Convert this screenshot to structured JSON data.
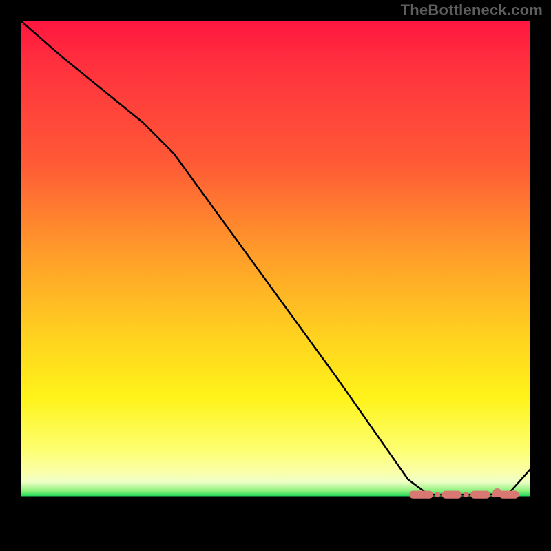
{
  "watermark": "TheBottleneck.com",
  "chart_data": {
    "type": "line",
    "title": "",
    "xlabel": "",
    "ylabel": "",
    "xlim": [
      0,
      100
    ],
    "ylim": [
      0,
      100
    ],
    "grid": false,
    "legend": false,
    "series": [
      {
        "name": "curve",
        "style": "solid-black",
        "x": [
          0,
          8,
          24,
          30,
          46,
          62,
          76,
          80,
          84,
          88,
          92,
          96,
          100
        ],
        "y": [
          100,
          93,
          80,
          74,
          52,
          30,
          10,
          7,
          7,
          7,
          7,
          7.5,
          12
        ]
      },
      {
        "name": "flat-segment-markers",
        "style": "dash-dot-salmon",
        "x": [
          77,
          80,
          84,
          88,
          91,
          93.5
        ],
        "y": [
          7,
          7,
          7,
          7,
          7,
          7.4
        ]
      }
    ],
    "annotations": [
      {
        "text": "TheBottleneck.com",
        "role": "watermark",
        "position": "top-right"
      }
    ],
    "gradient_bands_pct_from_top": {
      "red_to_orange": [
        0,
        45
      ],
      "orange_to_yellow": [
        45,
        84
      ],
      "pale_yellow": [
        84,
        91
      ],
      "green": [
        91,
        93.3
      ],
      "black_footer": [
        93.3,
        100
      ]
    }
  }
}
